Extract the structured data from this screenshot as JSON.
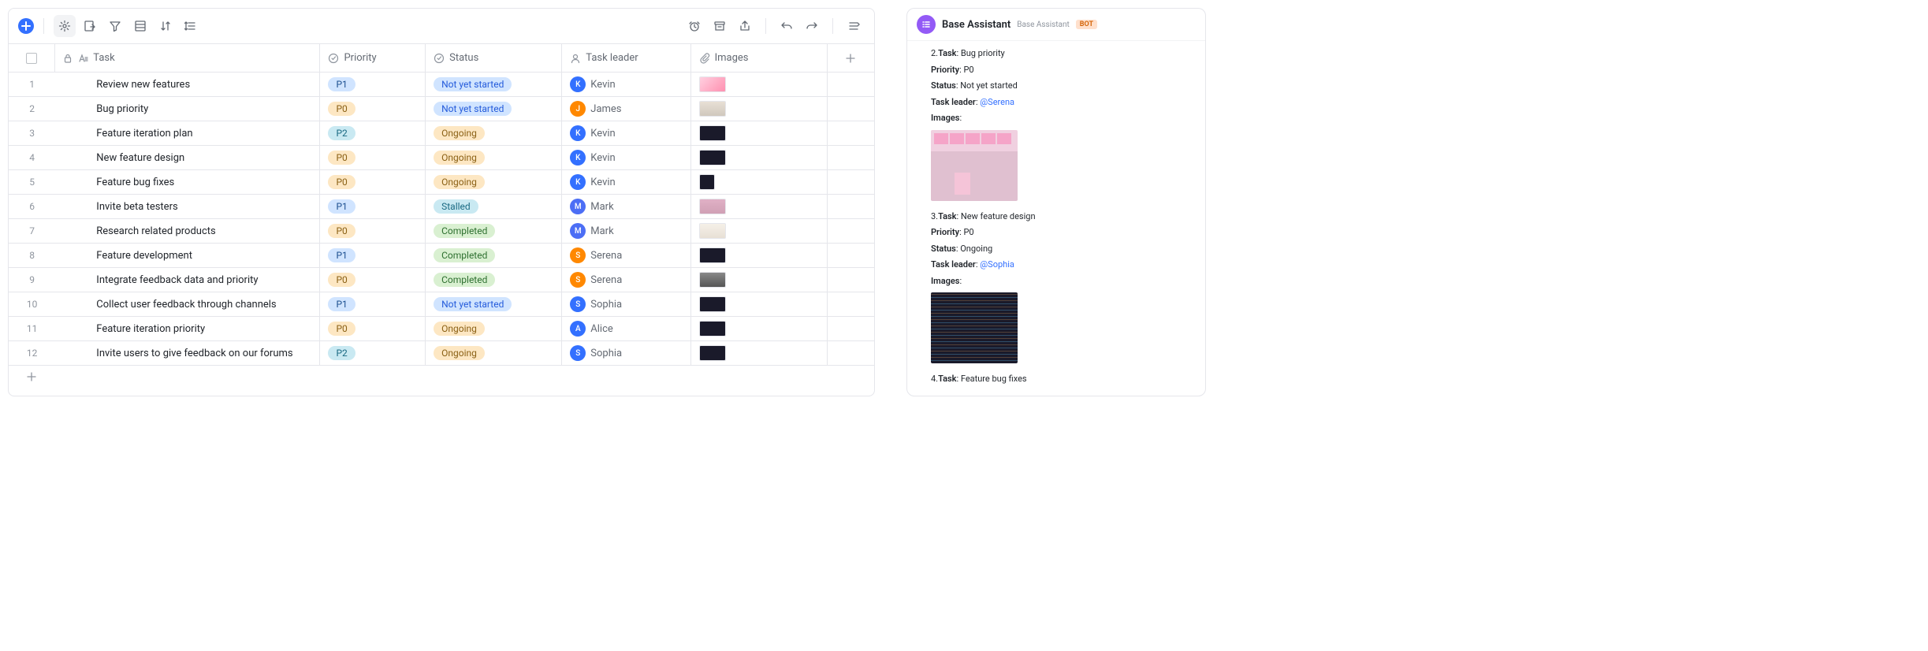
{
  "toolbar": {},
  "columns": {
    "task": "Task",
    "priority": "Priority",
    "status": "Status",
    "leader": "Task leader",
    "images": "Images"
  },
  "rows": [
    {
      "num": "1",
      "task": "Review new features",
      "priority": "P1",
      "priorityClass": "pill-blue-light",
      "status": "Not yet started",
      "statusClass": "pill-blue",
      "leader": "Kevin",
      "avatar": "K",
      "avatarClass": "av-blue",
      "thumbClass": "thumb-pink"
    },
    {
      "num": "2",
      "task": "Bug priority",
      "priority": "P0",
      "priorityClass": "pill-yellow",
      "status": "Not yet started",
      "statusClass": "pill-blue",
      "leader": "James",
      "avatar": "J",
      "avatarClass": "av-orange",
      "thumbClass": "thumb-desk"
    },
    {
      "num": "3",
      "task": "Feature iteration plan",
      "priority": "P2",
      "priorityClass": "pill-cyan",
      "status": "Ongoing",
      "statusClass": "pill-yellow",
      "leader": "Kevin",
      "avatar": "K",
      "avatarClass": "av-blue",
      "thumbClass": "thumb-dark"
    },
    {
      "num": "4",
      "task": "New feature design",
      "priority": "P0",
      "priorityClass": "pill-yellow",
      "status": "Ongoing",
      "statusClass": "pill-yellow",
      "leader": "Kevin",
      "avatar": "K",
      "avatarClass": "av-blue",
      "thumbClass": "thumb-dark"
    },
    {
      "num": "5",
      "task": "Feature bug fixes",
      "priority": "P0",
      "priorityClass": "pill-yellow",
      "status": "Ongoing",
      "statusClass": "pill-yellow",
      "leader": "Kevin",
      "avatar": "K",
      "avatarClass": "av-blue",
      "thumbClass": "thumb-dark",
      "thumbSmall": true
    },
    {
      "num": "6",
      "task": "Invite beta testers",
      "priority": "P1",
      "priorityClass": "pill-blue-light",
      "status": "Stalled",
      "statusClass": "pill-cyan",
      "leader": "Mark",
      "avatar": "M",
      "avatarClass": "av-navy",
      "thumbClass": "thumb-sticky"
    },
    {
      "num": "7",
      "task": "Research related products",
      "priority": "P0",
      "priorityClass": "pill-yellow",
      "status": "Completed",
      "statusClass": "pill-green",
      "leader": "Mark",
      "avatar": "M",
      "avatarClass": "av-navy",
      "thumbClass": "thumb-paper"
    },
    {
      "num": "8",
      "task": "Feature development",
      "priority": "P1",
      "priorityClass": "pill-blue-light",
      "status": "Completed",
      "statusClass": "pill-green",
      "leader": "Serena",
      "avatar": "S",
      "avatarClass": "av-orange",
      "thumbClass": "thumb-dark"
    },
    {
      "num": "9",
      "task": "Integrate feedback data and priority",
      "priority": "P0",
      "priorityClass": "pill-yellow",
      "status": "Completed",
      "statusClass": "pill-green",
      "leader": "Serena",
      "avatar": "S",
      "avatarClass": "av-orange",
      "thumbClass": "thumb-bw"
    },
    {
      "num": "10",
      "task": "Collect user feedback through channels",
      "priority": "P1",
      "priorityClass": "pill-blue-light",
      "status": "Not yet started",
      "statusClass": "pill-blue",
      "leader": "Sophia",
      "avatar": "S",
      "avatarClass": "av-blue",
      "thumbClass": "thumb-dark"
    },
    {
      "num": "11",
      "task": "Feature iteration priority",
      "priority": "P0",
      "priorityClass": "pill-yellow",
      "status": "Ongoing",
      "statusClass": "pill-yellow",
      "leader": "Alice",
      "avatar": "A",
      "avatarClass": "av-blue",
      "thumbClass": "thumb-dark"
    },
    {
      "num": "12",
      "task": "Invite users to give feedback on our forums",
      "priority": "P2",
      "priorityClass": "pill-cyan",
      "status": "Ongoing",
      "statusClass": "pill-yellow",
      "leader": "Sophia",
      "avatar": "S",
      "avatarClass": "av-blue",
      "thumbClass": "thumb-dark"
    }
  ],
  "assistant": {
    "title": "Base Assistant",
    "subtitle": "Base Assistant",
    "badge": "BOT",
    "items": [
      {
        "n": "2",
        "task": "Bug priority",
        "priority": "P0",
        "status": "Not yet started",
        "leader": "@Serena",
        "leaderLink": true,
        "imagesLabel": "Images",
        "imgType": "sticky"
      },
      {
        "n": "3",
        "task": "New feature design",
        "priority": "P0",
        "status": "Ongoing",
        "leader": "@Sophia",
        "leaderLink": true,
        "imagesLabel": "Images",
        "imgType": "code"
      },
      {
        "n": "4",
        "task": "Feature bug fixes"
      }
    ],
    "labels": {
      "task": "Task",
      "priority": "Priority",
      "status": "Status",
      "leader": "Task leader",
      "images": "Images"
    }
  }
}
